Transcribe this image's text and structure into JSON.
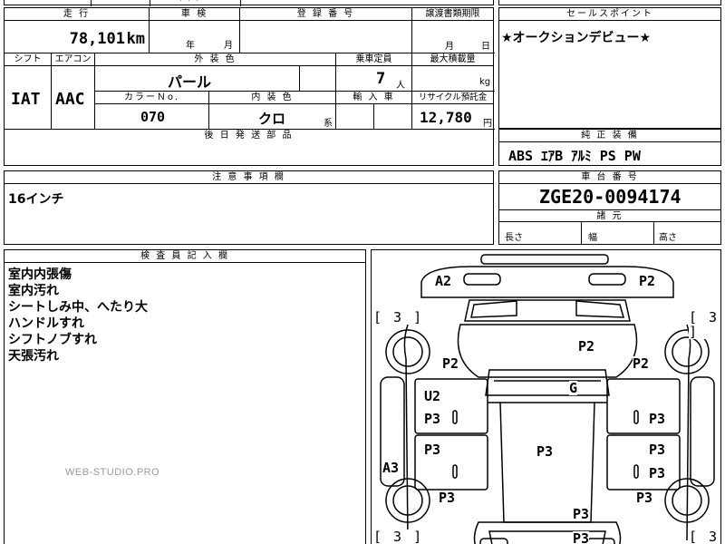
{
  "top_fragment": "・・・",
  "mileage": {
    "header": "走 行",
    "value": "78,101",
    "unit": "km"
  },
  "inspection": {
    "header": "車 検",
    "year_unit": "年",
    "month_unit": "月"
  },
  "registration": {
    "header": "登 録 番 号",
    "value": ""
  },
  "transfer_deadline": {
    "header": "譲渡書類期限",
    "month_unit": "月",
    "day_unit": "日"
  },
  "sales_point": {
    "header": "セールスポイント",
    "text": "★オークションデビュー★"
  },
  "shift": {
    "header": "シフト",
    "value": "IAT"
  },
  "aircon": {
    "header": "エアコン",
    "value": "AAC"
  },
  "exterior_color": {
    "header": "外 装 色",
    "value": "パール"
  },
  "capacity": {
    "header": "乗車定員",
    "value": "7",
    "unit": "人"
  },
  "max_load": {
    "header": "最大積載量",
    "unit": "kg"
  },
  "color_no": {
    "header": "カラーＮo.",
    "value": "070"
  },
  "interior_color": {
    "header": "内 装 色",
    "value": "クロ",
    "unit": "系"
  },
  "import_car": {
    "header": "輸 入 車"
  },
  "recycle": {
    "header": "リサイクル預託金",
    "value": "12,780",
    "unit": "円"
  },
  "later_parts": {
    "header": "後 日 発 送 部 品"
  },
  "options": {
    "header": "純 正 装 備",
    "value": "ABS ｴｱB ｱﾙﾐ PS PW"
  },
  "notes": {
    "header": "注 意 事 項 欄",
    "text": "16インチ"
  },
  "chassis": {
    "header": "車 台 番 号",
    "value": "ZGE20-0094174"
  },
  "dimensions": {
    "header": "諸 元",
    "length": "長さ",
    "width": "幅",
    "height": "高さ"
  },
  "inspector": {
    "header": "検 査 員 記 入 欄",
    "lines": [
      "室内内張傷",
      "室内汚れ",
      "シートしみ中、へたり大",
      "ハンドルすれ",
      "シフトノブすれ",
      "天張汚れ"
    ]
  },
  "watermark": "WEB-STUDIO.PRO",
  "diagram": {
    "brackets": [
      "[ 3 ]",
      "[ 3 ]",
      "[ 3 ]",
      "[ 3 ]"
    ],
    "marks": [
      "A2",
      "P2",
      "P2",
      "P2",
      "P2",
      "G",
      "U2",
      "P3",
      "P3",
      "P3",
      "P3",
      "P3",
      "P3",
      "A3",
      "P3",
      "P3",
      "P3",
      "P3"
    ]
  }
}
